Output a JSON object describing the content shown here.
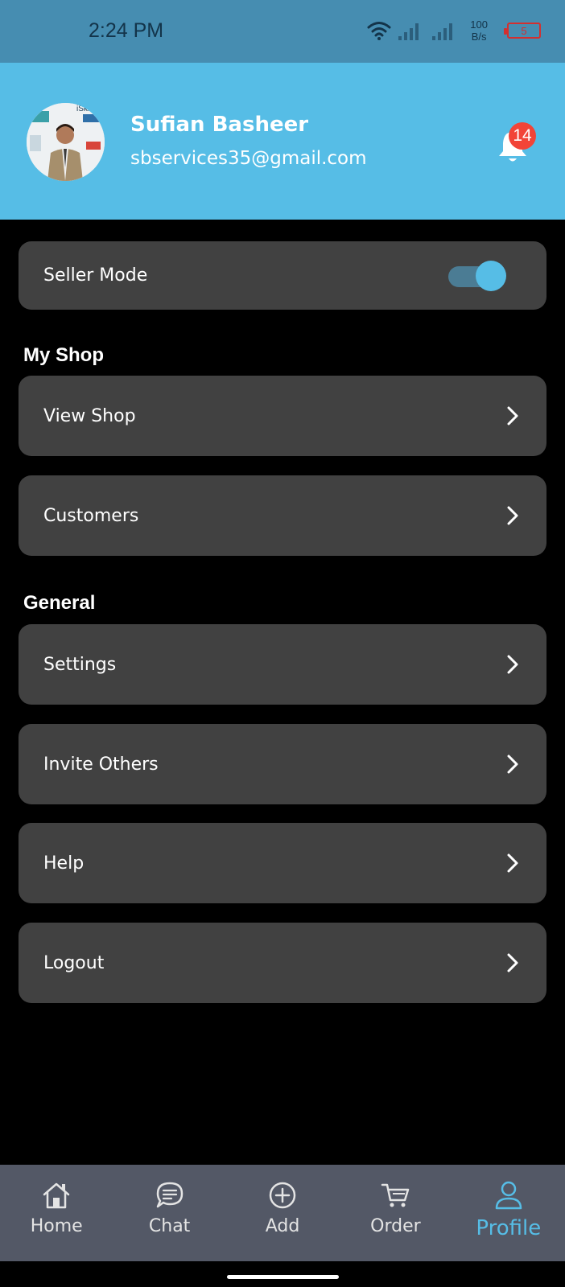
{
  "status_bar": {
    "time": "2:24 PM",
    "speed_value": "100",
    "speed_unit": "B/s",
    "battery": "5"
  },
  "profile": {
    "name": "Sufian Basheer",
    "email": "sbservices35@gmail.com",
    "avatar_text": "iSkills",
    "notification_count": "14"
  },
  "seller_mode": {
    "label": "Seller Mode",
    "enabled": true
  },
  "sections": {
    "my_shop": {
      "title": "My Shop",
      "items": [
        {
          "label": "View Shop"
        },
        {
          "label": "Customers"
        }
      ]
    },
    "general": {
      "title": "General",
      "items": [
        {
          "label": "Settings"
        },
        {
          "label": "Invite Others"
        },
        {
          "label": "Help"
        },
        {
          "label": "Logout"
        }
      ]
    }
  },
  "bottom_nav": {
    "items": [
      {
        "label": "Home",
        "icon": "home-icon"
      },
      {
        "label": "Chat",
        "icon": "chat-icon"
      },
      {
        "label": "Add",
        "icon": "add-circle-icon"
      },
      {
        "label": "Order",
        "icon": "cart-icon"
      },
      {
        "label": "Profile",
        "icon": "person-icon",
        "active": true
      }
    ]
  },
  "colors": {
    "header_bg": "#56bde6",
    "status_bar_bg": "#468db1",
    "card_bg": "#414141",
    "accent": "#56bde6",
    "badge": "#f24438",
    "nav_bg": "#535866"
  }
}
